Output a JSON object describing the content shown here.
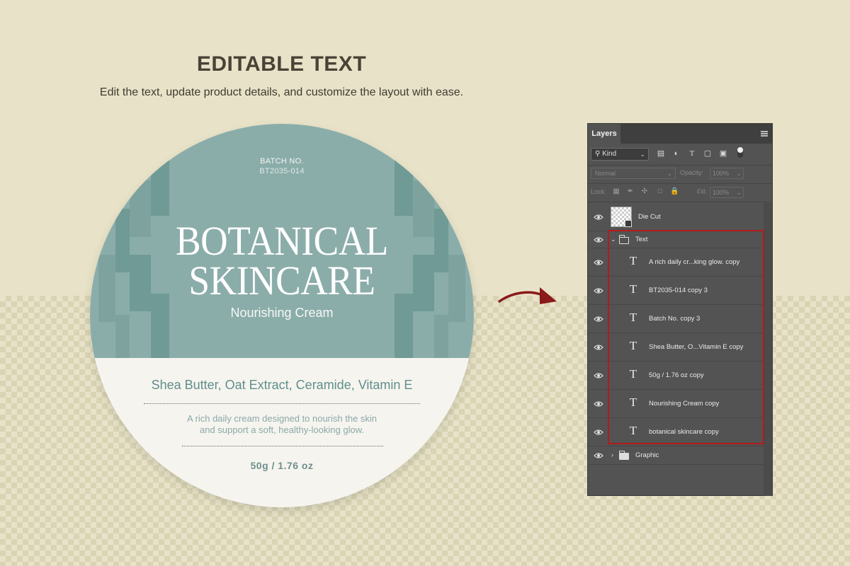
{
  "page": {
    "headline": "EDITABLE TEXT",
    "subline": "Edit the text, update product details, and customize the layout with ease."
  },
  "label": {
    "batch_label": "BATCH NO.",
    "batch_code": "BT2035-014",
    "title_line1": "BOTANICAL",
    "title_line2": "SKINCARE",
    "subtitle": "Nourishing Cream",
    "ingredients": "Shea Butter, Oat Extract, Ceramide, Vitamin E",
    "desc_line1": "A rich daily cream designed to nourish the skin",
    "desc_line2": "and support a soft, healthy-looking glow.",
    "weight": "50g / 1.76 oz",
    "colors": {
      "teal": "#8badaa",
      "teal_dark": "#6f9a95",
      "cream": "#f6f4ef"
    }
  },
  "layers_panel": {
    "tab": "Layers",
    "filter_kind": "Kind",
    "blend_mode": "Normal",
    "opacity_label": "Opacity:",
    "opacity_value": "100%",
    "lock_label": "Lock:",
    "fill_label": "Fill:",
    "fill_value": "100%",
    "layers": {
      "die_cut": "Die Cut",
      "text_group": "Text",
      "text_layers": [
        "A rich daily cr...king glow. copy",
        "BT2035-014 copy 3",
        "Batch No. copy 3",
        "Shea Butter, O...Vitamin E copy",
        "50g / 1.76 oz copy",
        "Nourishing Cream copy",
        "botanical skincare copy"
      ],
      "graphic_group": "Graphic"
    },
    "highlight_color": "#b31a1a"
  }
}
